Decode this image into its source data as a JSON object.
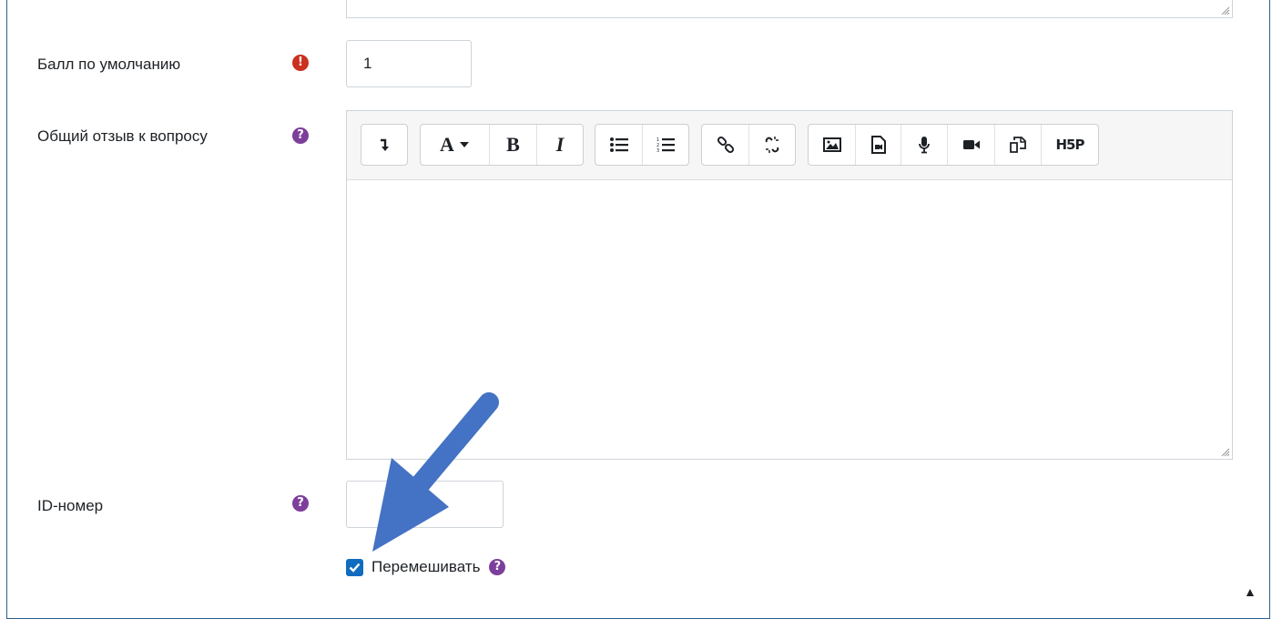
{
  "form": {
    "default_mark": {
      "label": "Балл по умолчанию",
      "value": "1"
    },
    "general_feedback": {
      "label": "Общий отзыв к вопросу"
    },
    "id_number": {
      "label": "ID-номер",
      "value": ""
    },
    "shuffle": {
      "label": "Перемешивать",
      "checked": true
    }
  },
  "toolbar": {
    "groups": [
      [
        "collapse-icon"
      ],
      [
        "font-style-icon",
        "bold-icon",
        "italic-icon"
      ],
      [
        "unordered-list-icon",
        "ordered-list-icon"
      ],
      [
        "link-icon",
        "unlink-icon"
      ],
      [
        "image-icon",
        "media-icon",
        "record-audio-icon",
        "record-video-icon",
        "manage-files-icon",
        "h5p-icon"
      ]
    ],
    "font_style_label": "A",
    "bold_label": "B",
    "italic_label": "I",
    "h5p_label": "H5P"
  },
  "colors": {
    "required_icon": "#ca3120",
    "help_icon": "#7c3f9b",
    "checkbox": "#0f6cbf",
    "annotation_arrow": "#4472c4",
    "frame_border": "#2e5f8a"
  }
}
